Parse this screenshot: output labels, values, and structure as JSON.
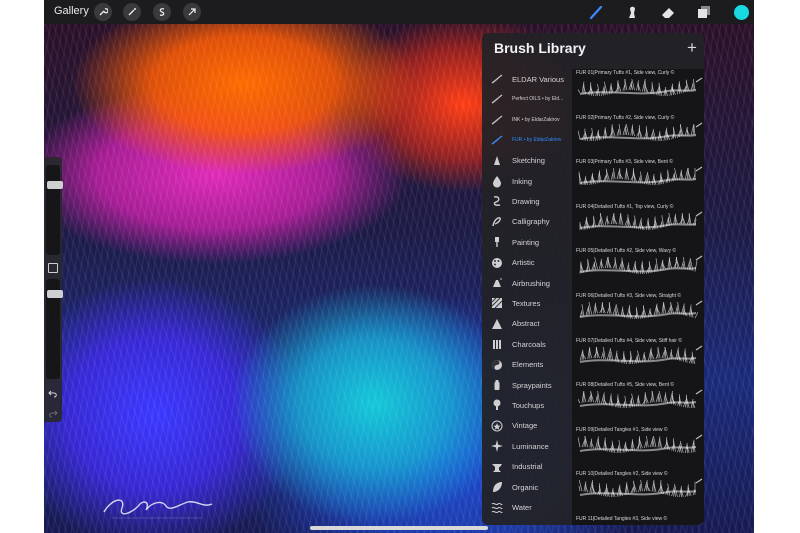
{
  "topbar": {
    "gallery_label": "Gallery",
    "left_tools": [
      "wrench-icon",
      "magic-wand-icon",
      "selection-icon",
      "transform-arrow-icon"
    ],
    "right_tools": [
      "brush-icon",
      "smudge-icon",
      "eraser-icon",
      "layers-icon",
      "color-swatch-icon"
    ],
    "active_color": "#18d9e0",
    "brush_active_color": "#3b8bff"
  },
  "brush_library": {
    "title": "Brush Library",
    "add_symbol": "+",
    "sets": [
      {
        "label": "ELDAR Various",
        "icon": "custom-stroke-icon",
        "small": false,
        "active": false
      },
      {
        "label": "Perfect OILS • by Eld...",
        "icon": "custom-stroke-icon",
        "small": true,
        "active": false
      },
      {
        "label": "INK • by EldarZakirov",
        "icon": "custom-stroke-icon",
        "small": true,
        "active": false
      },
      {
        "label": "FUR • by EldarZakirov",
        "icon": "custom-stroke-icon",
        "small": true,
        "active": true
      },
      {
        "label": "Sketching",
        "icon": "pencil-tip-icon",
        "small": false,
        "active": false
      },
      {
        "label": "Inking",
        "icon": "ink-drop-icon",
        "small": false,
        "active": false
      },
      {
        "label": "Drawing",
        "icon": "drawing-swirl-icon",
        "small": false,
        "active": false
      },
      {
        "label": "Calligraphy",
        "icon": "calligraphy-icon",
        "small": false,
        "active": false
      },
      {
        "label": "Painting",
        "icon": "paintbrush-icon",
        "small": false,
        "active": false
      },
      {
        "label": "Artistic",
        "icon": "palette-icon",
        "small": false,
        "active": false
      },
      {
        "label": "Airbrushing",
        "icon": "airbrush-icon",
        "small": false,
        "active": false
      },
      {
        "label": "Textures",
        "icon": "texture-icon",
        "small": false,
        "active": false
      },
      {
        "label": "Abstract",
        "icon": "triangle-icon",
        "small": false,
        "active": false
      },
      {
        "label": "Charcoals",
        "icon": "charcoal-icon",
        "small": false,
        "active": false
      },
      {
        "label": "Elements",
        "icon": "yin-yang-icon",
        "small": false,
        "active": false
      },
      {
        "label": "Spraypaints",
        "icon": "spray-can-icon",
        "small": false,
        "active": false
      },
      {
        "label": "Touchups",
        "icon": "touchup-icon",
        "small": false,
        "active": false
      },
      {
        "label": "Vintage",
        "icon": "star-badge-icon",
        "small": false,
        "active": false
      },
      {
        "label": "Luminance",
        "icon": "sparkle-icon",
        "small": false,
        "active": false
      },
      {
        "label": "Industrial",
        "icon": "anvil-icon",
        "small": false,
        "active": false
      },
      {
        "label": "Organic",
        "icon": "leaf-icon",
        "small": false,
        "active": false
      },
      {
        "label": "Water",
        "icon": "waves-icon",
        "small": false,
        "active": false
      }
    ],
    "brushes": [
      "FUR 01|Primary Tufts #1, Side view, Curly ©",
      "FUR 02|Primary Tufts #2, Side view, Curly ©",
      "FUR 03|Primary Tufts #3, Side view, Bent ©",
      "FUR 04|Detailed Tufts #1, Top view, Curly ©",
      "FUR 05|Detailed Tufts #2, Side view, Wavy ©",
      "FUR 06|Detailed Tufts #3, Side view, Straight ©",
      "FUR 07|Detailed Tufts #4, Side view, Stiff hair ©",
      "FUR 08|Detailed Tufts #5, Side view, Bent ©",
      "FUR 09|Detailed Tangles #1, Side view ©",
      "FUR 10|Detailed Tangles #2, Side view ©",
      "FUR 11|Detailed Tangles #3, Side view ©"
    ]
  },
  "sidebar": {
    "brush_size_level": 0.2,
    "opacity_level": 0.12,
    "modify_button_icon": "square-modifier-icon",
    "undo_icon": "undo-arrow-icon",
    "redo_icon": "redo-arrow-icon"
  }
}
